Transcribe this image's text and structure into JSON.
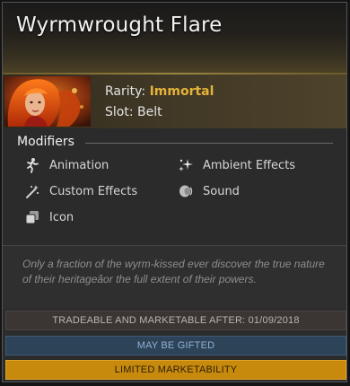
{
  "item": {
    "name": "Wyrmwrought Flare",
    "rarity_label": "Rarity:",
    "rarity_value": "Immortal",
    "slot_label": "Slot:",
    "slot_value": "Belt",
    "rarity_color": "#e5b33a"
  },
  "modifiers": {
    "heading": "Modifiers",
    "items": [
      {
        "label": "Animation",
        "icon": "running-figure-icon"
      },
      {
        "label": "Ambient Effects",
        "icon": "sparkles-icon"
      },
      {
        "label": "Custom Effects",
        "icon": "magic-wand-icon"
      },
      {
        "label": "Sound",
        "icon": "speaker-icon"
      },
      {
        "label": "Icon",
        "icon": "stacked-squares-icon"
      }
    ]
  },
  "description": "Only a fraction of the wyrm-kissed ever discover the true nature of their heritageâor the full extent of their powers.",
  "status_bars": {
    "trade": "TRADEABLE AND MARKETABLE AFTER: 01/09/2018",
    "gift": "MAY BE GIFTED",
    "limited": "LIMITED MARKETABILITY"
  },
  "colors": {
    "trade_bg": "#3b3633",
    "gift_bg": "#2d4357",
    "limited_bg": "#c88a0d"
  }
}
